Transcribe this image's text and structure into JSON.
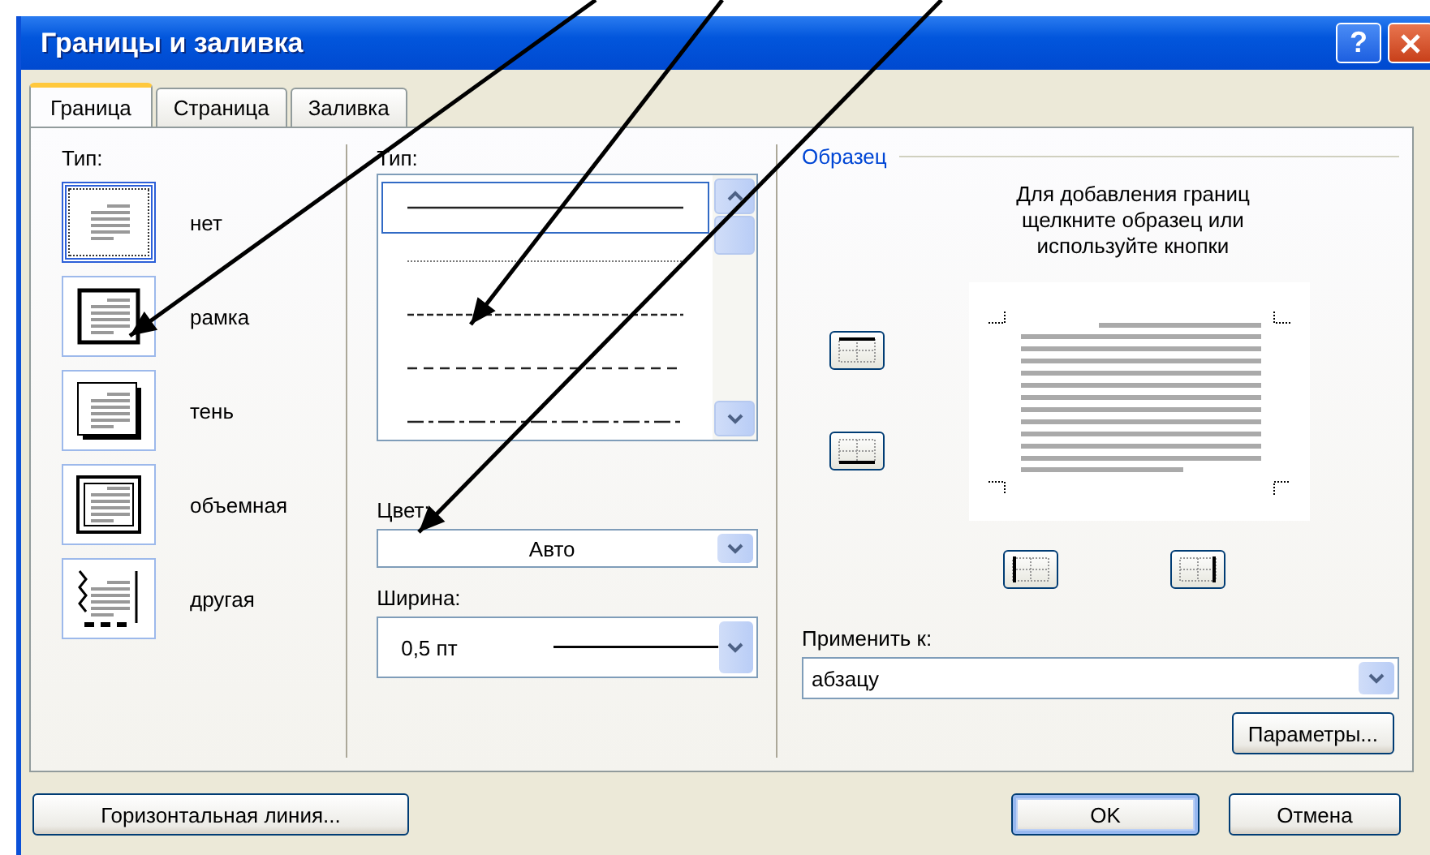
{
  "window": {
    "title": "Границы и заливка"
  },
  "title_buttons": [
    {
      "kind": "help",
      "label": "?"
    },
    {
      "kind": "close"
    }
  ],
  "tabs": [
    {
      "label": "Граница",
      "selected": true
    },
    {
      "label": "Страница",
      "selected": false
    },
    {
      "label": "Заливка",
      "selected": false
    }
  ],
  "setting": {
    "label": "Тип:",
    "options": [
      {
        "kind": "none",
        "label": "нет",
        "selected": true
      },
      {
        "kind": "box",
        "label": "рамка",
        "selected": false
      },
      {
        "kind": "shadow",
        "label": "тень",
        "selected": false
      },
      {
        "kind": "double",
        "label": "объемная",
        "selected": false
      },
      {
        "kind": "custom",
        "label": "другая",
        "selected": false
      }
    ]
  },
  "style": {
    "label": "Тип:",
    "lines": [
      {
        "kind": "solid",
        "selected": true
      },
      {
        "kind": "dotted",
        "selected": false
      },
      {
        "kind": "dashed-small",
        "selected": false
      },
      {
        "kind": "dashed",
        "selected": false
      },
      {
        "kind": "dash-dot",
        "selected": false
      }
    ]
  },
  "color": {
    "label": "Цвет:",
    "value": "Авто"
  },
  "width": {
    "label": "Ширина:",
    "value": "0,5 пт"
  },
  "preview": {
    "title": "Образец",
    "hint": "Для добавления границ\nщелкните образец или\nиспользуйте кнопки"
  },
  "border_buttons": [
    {
      "kind": "top"
    },
    {
      "kind": "bottom"
    },
    {
      "kind": "left"
    },
    {
      "kind": "right"
    }
  ],
  "apply_to": {
    "label": "Применить к:",
    "value": "абзацу"
  },
  "options_button": "Параметры...",
  "buttons": [
    {
      "label": "Горизонтальная линия...",
      "default": false
    },
    {
      "label": "OK",
      "default": true
    },
    {
      "label": "Отмена",
      "default": false
    }
  ]
}
